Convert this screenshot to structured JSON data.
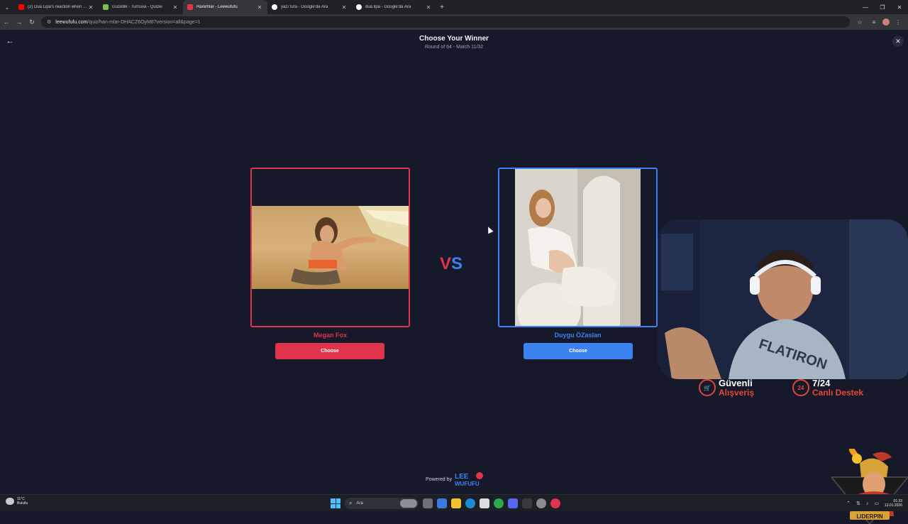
{
  "browser": {
    "tabs": [
      {
        "title": "(2) Dua Lipa's reaction when R...",
        "favicon_color": "#ff0000",
        "active": false
      },
      {
        "title": "Güzellik - Turnuva - Quizei",
        "favicon_color": "#7bbf4a",
        "active": false
      },
      {
        "title": "Haremlar - Leewufufu",
        "favicon_color": "#e0344c",
        "active": true
      },
      {
        "title": "yazı tura - Google'da Ara",
        "favicon_color": "#ffffff",
        "active": false
      },
      {
        "title": "dua lipa - Google'da Ara",
        "favicon_color": "#ffffff",
        "active": false
      }
    ],
    "url_host": "leewufufu.com",
    "url_path": "/quiz/han-mlar-DHACZ6OyM8?version=all&page=1"
  },
  "quiz": {
    "title": "Choose Your Winner",
    "subtitle": "Round of 64 - Match 11/32",
    "vs_v": "V",
    "vs_s": "S",
    "left": {
      "name": "Megan Fox",
      "button": "Choose",
      "color": "#e0344c"
    },
    "right": {
      "name": "Duygu ÖZaslan",
      "button": "Choose",
      "color": "#3d82f1"
    },
    "powered_by": "Powered by",
    "logo_text": "LEEWUFUFU"
  },
  "overlay": {
    "promo1_line1": "Güvenli",
    "promo1_line2": "Alışveriş",
    "promo2_line1": "7/24",
    "promo2_line2": "Canlı Destek",
    "promo2_badge": "24",
    "mascot_label": "LIDERPIN"
  },
  "taskbar": {
    "weather_temp": "11°C",
    "weather_desc": "Bulutlu",
    "search_placeholder": "Ara",
    "time": "01:33",
    "date": "13.01.2026"
  }
}
